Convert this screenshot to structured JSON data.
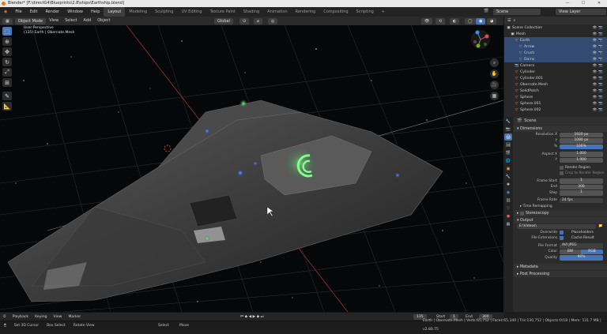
{
  "window": {
    "title": "Blender* [F:\\directG4\\Blueprints\\2.8\\ships\\Earthship.blend]",
    "scene_label": "Scene",
    "viewlayer_label": "View Layer"
  },
  "menu": [
    "File",
    "Edit",
    "Render",
    "Window",
    "Help"
  ],
  "workspaces": [
    "Layout",
    "Modeling",
    "Sculpting",
    "UV Editing",
    "Texture Paint",
    "Shading",
    "Animation",
    "Rendering",
    "Compositing",
    "Scripting"
  ],
  "active_workspace": "Layout",
  "viewport_header": {
    "mode": "Object Mode",
    "menus": [
      "View",
      "Select",
      "Add",
      "Object"
    ],
    "orientation": "Global"
  },
  "viewport_info": {
    "line1": "User Perspective",
    "line2": "(135) Earth | Obernate.Mesh"
  },
  "outliner": {
    "title": "Scene Collection",
    "rows": [
      {
        "label": "Scene Collection",
        "indent": 0,
        "selected": false,
        "icon": "collection-icon"
      },
      {
        "label": "Mesh",
        "indent": 1,
        "selected": false,
        "icon": "collection-icon"
      },
      {
        "label": "Earth",
        "indent": 2,
        "selected": true,
        "icon": "object-icon"
      },
      {
        "label": "Arrow",
        "indent": 3,
        "selected": true,
        "icon": "mesh-icon"
      },
      {
        "label": "Crush",
        "indent": 3,
        "selected": true,
        "icon": "mesh-icon"
      },
      {
        "label": "Dams",
        "indent": 3,
        "selected": true,
        "icon": "mesh-icon"
      },
      {
        "label": "Camera",
        "indent": 2,
        "selected": false,
        "icon": "camera-icon"
      },
      {
        "label": "Cylinder",
        "indent": 2,
        "selected": false,
        "icon": "mesh-icon"
      },
      {
        "label": "Cylinder.001",
        "indent": 2,
        "selected": false,
        "icon": "mesh-icon"
      },
      {
        "label": "Obernate.Mesh",
        "indent": 2,
        "selected": false,
        "icon": "mesh-icon"
      },
      {
        "label": "SolidPatch",
        "indent": 2,
        "selected": false,
        "icon": "mesh-icon"
      },
      {
        "label": "Sphere",
        "indent": 2,
        "selected": false,
        "icon": "mesh-icon"
      },
      {
        "label": "Sphere.001",
        "indent": 2,
        "selected": false,
        "icon": "mesh-icon"
      },
      {
        "label": "Sphere.002",
        "indent": 2,
        "selected": false,
        "icon": "mesh-icon"
      }
    ]
  },
  "properties": {
    "scene_name": "Scene",
    "dimensions": {
      "title": "Dimensions",
      "resolution_x_label": "Resolution X",
      "resolution_x": "1920 px",
      "y_label": "Y",
      "resolution_y": "1080 px",
      "percent_label": "%",
      "percent": "100%",
      "aspect_x_label": "Aspect X",
      "aspect_x": "1.000",
      "aspect_y_label": "Y",
      "aspect_y": "1.000",
      "render_region": "Render Region",
      "crop": "Crop to Render Region",
      "frame_start_label": "Frame Start",
      "frame_start": "1",
      "end_label": "End",
      "end": "300",
      "step_label": "Step",
      "step": "1",
      "frame_rate_label": "Frame Rate",
      "frame_rate": "24 fps",
      "time_remapping": "Time Remapping"
    },
    "stereoscopy": "Stereoscopy",
    "output": {
      "title": "Output",
      "path": "E:\\Videos\\",
      "overwrite": "Overwrite",
      "placeholders": "Placeholders",
      "file_extensions": "File Extensions",
      "cache_result": "Cache Result",
      "file_format_label": "File Format",
      "file_format": "AVI JPEG",
      "color_label": "Color",
      "color_bw": "BW",
      "color_rgb": "RGB",
      "quality_label": "Quality",
      "quality": "90%"
    },
    "metadata": "Metadata",
    "post_processing": "Post Processing"
  },
  "timeline": {
    "menus": [
      "Playback",
      "Keying",
      "View",
      "Marker"
    ],
    "current_frame": "135",
    "start_label": "Start",
    "start": "1",
    "end_label": "End",
    "end": "300"
  },
  "status": {
    "left": [
      "Set 3D Cursor",
      "Box Select",
      "Rotate View"
    ],
    "mid": [
      "Select",
      "Move"
    ],
    "stats": "Earth | Obernate.Mesh | Verts:65,752 | Faces:65,340 | Tris:130,752 | Objects:0/18 | Mem: 131.7 MB | v2.80.75"
  },
  "colors": {
    "accent": "#4772b3",
    "selected_row": "#334a73",
    "glow_green": "#5dff6a",
    "engine_blue": "#3a5cff"
  }
}
